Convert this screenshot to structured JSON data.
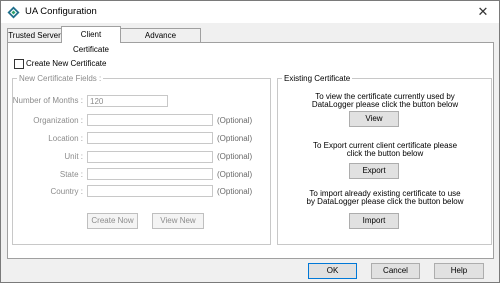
{
  "window": {
    "title": "UA Configuration",
    "close_glyph": "✕"
  },
  "tabs": [
    {
      "label": "Trusted Server"
    },
    {
      "label": "Client Certificate"
    },
    {
      "label": "Advance Configuration"
    }
  ],
  "create_new_certificate": {
    "label": "Create New Certificate",
    "checked": false
  },
  "new_certificate_fields": {
    "legend": "New Certificate Fields :",
    "number_of_months": {
      "label": "Number of Months :",
      "value": "120"
    },
    "organization": {
      "label": "Organization :",
      "value": "",
      "hint": "(Optional)"
    },
    "location": {
      "label": "Location :",
      "value": "",
      "hint": "(Optional)"
    },
    "unit": {
      "label": "Unit :",
      "value": "",
      "hint": "(Optional)"
    },
    "state": {
      "label": "State :",
      "value": "",
      "hint": "(Optional)"
    },
    "country": {
      "label": "Country :",
      "value": "",
      "hint": "(Optional)"
    },
    "create_now_label": "Create Now",
    "view_new_label": "View New"
  },
  "existing_certificate": {
    "legend": "Existing Certificate",
    "view_text_1": "To view the certificate currently used by",
    "view_text_2": "DataLogger please click the button below",
    "view_label": "View",
    "export_text_1": "To Export current client certificate please",
    "export_text_2": "click the button below",
    "export_label": "Export",
    "import_text_1": "To import already existing certificate to use",
    "import_text_2": "by DataLogger please click the button below",
    "import_label": "Import"
  },
  "footer": {
    "ok_label": "OK",
    "cancel_label": "Cancel",
    "help_label": "Help"
  },
  "colors": {
    "window_bg": "#f0f0f0",
    "panel_bg": "#ffffff",
    "accent": "#0078d7",
    "disabled_text": "#8c8c8c"
  },
  "icons": {
    "app": "ua-app-icon",
    "close": "close-icon"
  }
}
